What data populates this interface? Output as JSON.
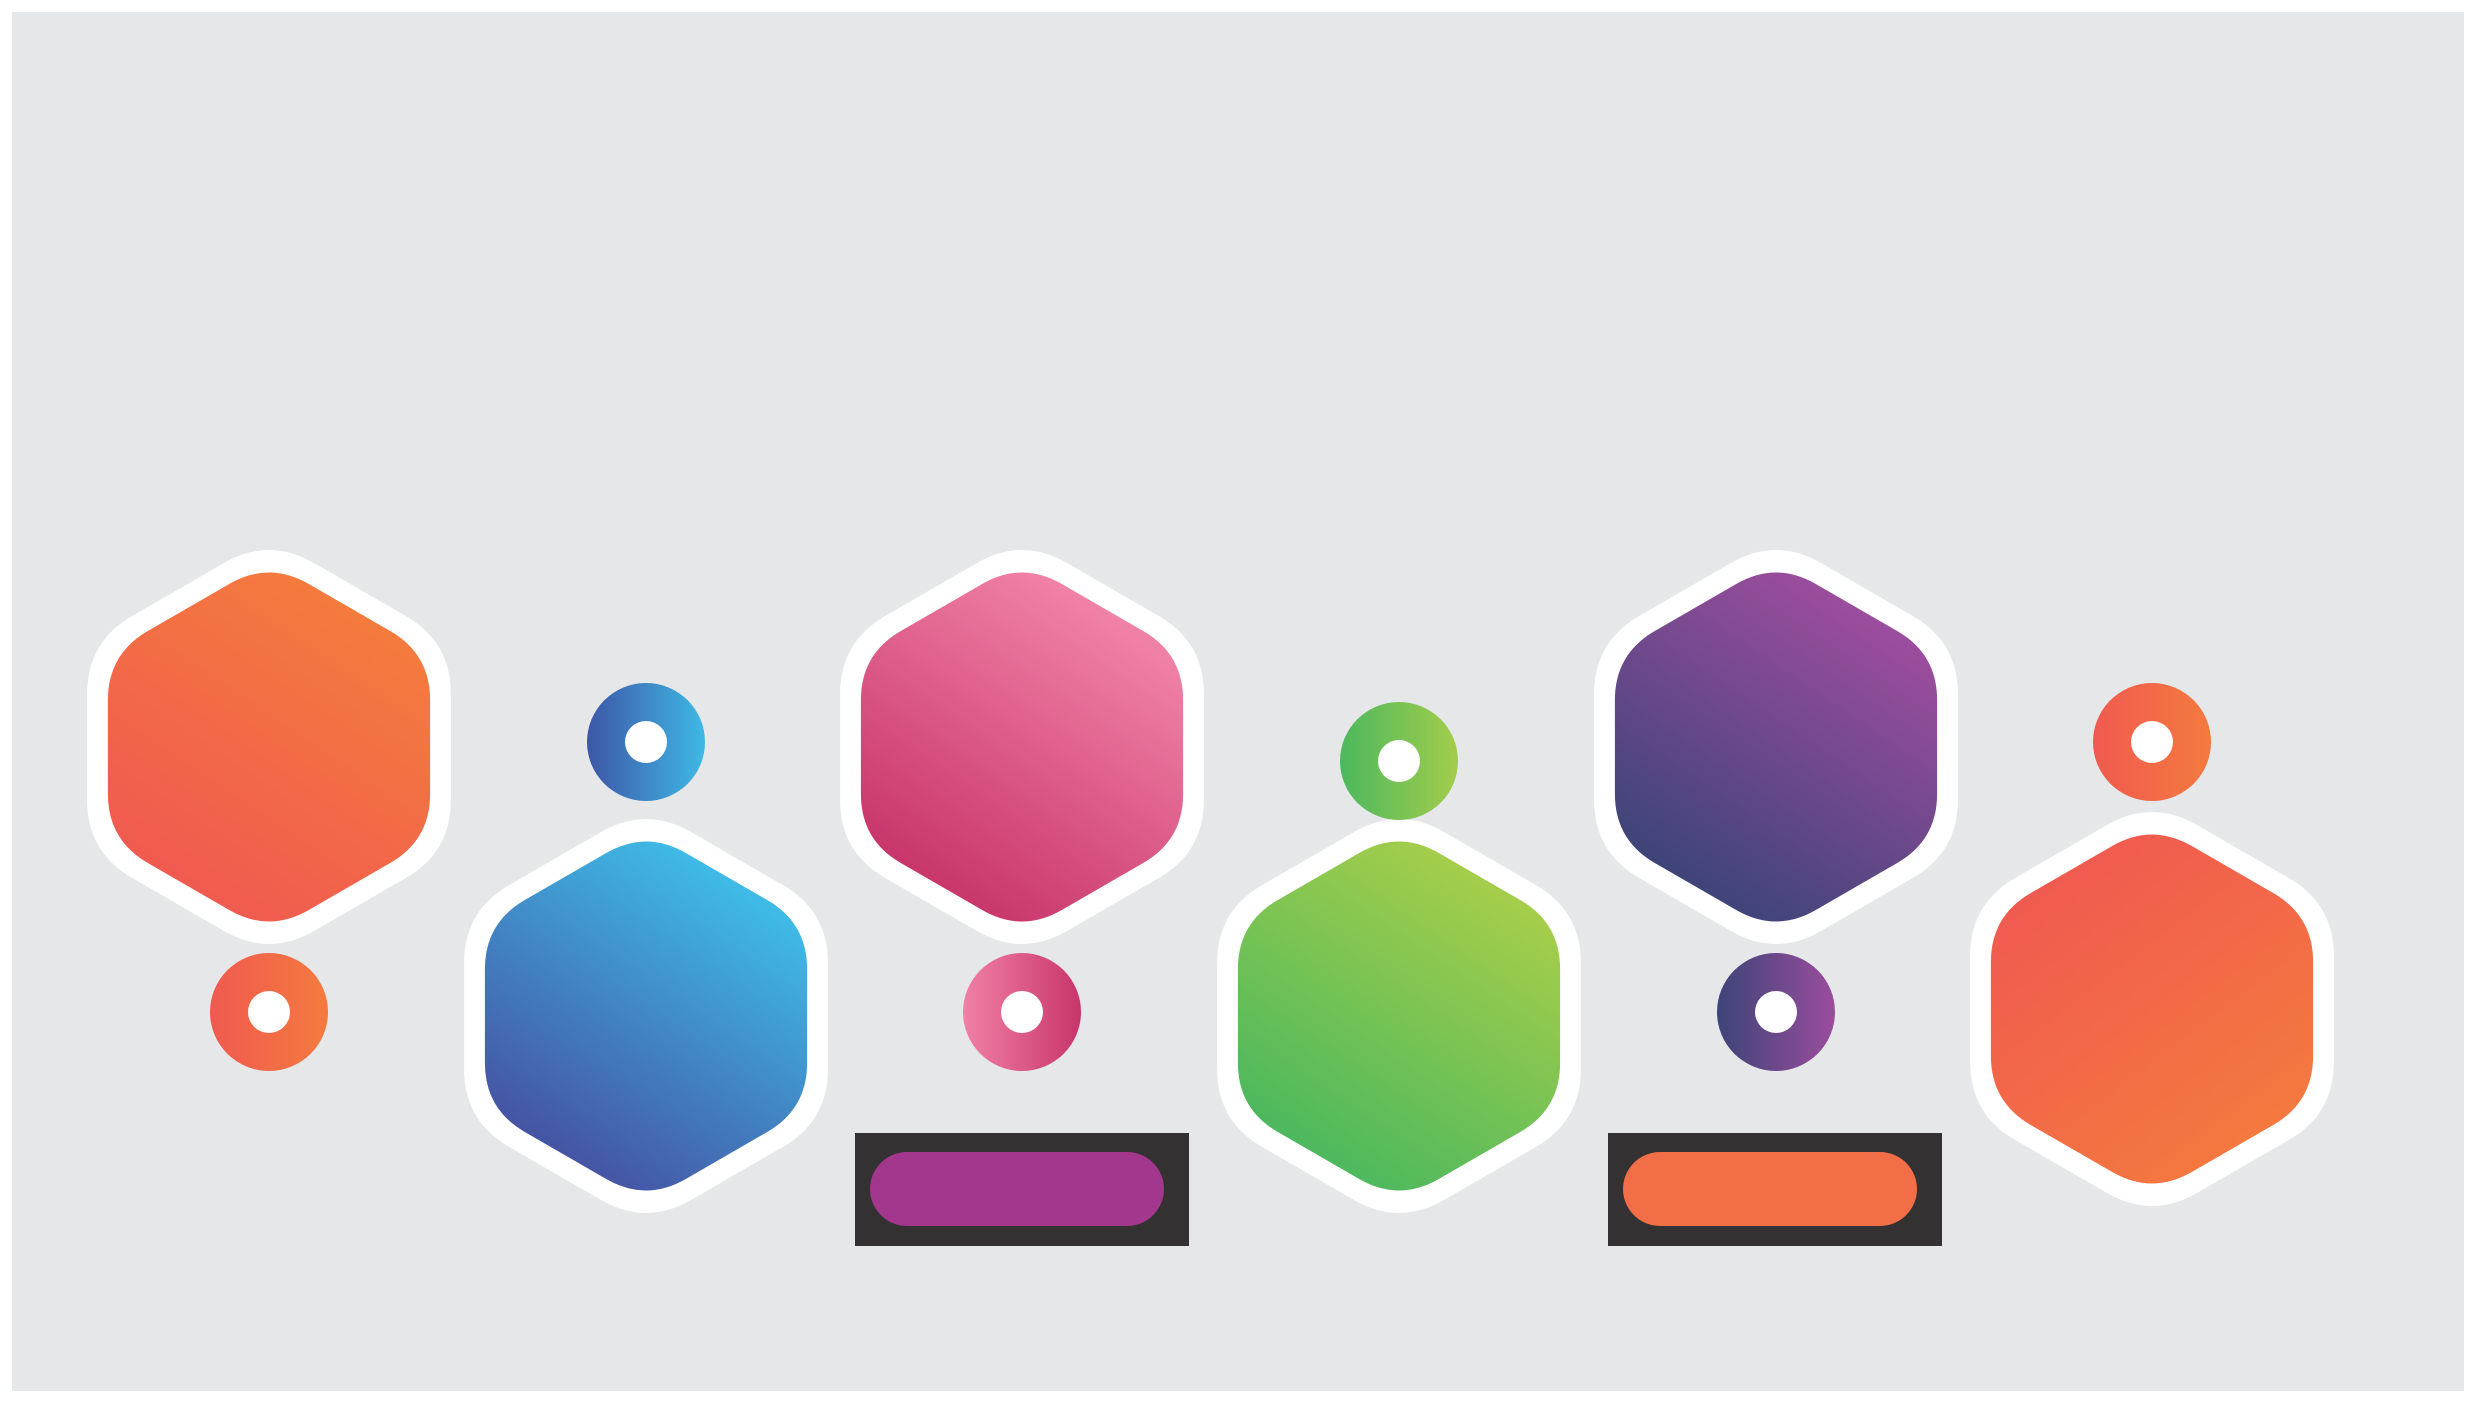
{
  "canvas": {
    "background": "#ffffff",
    "panel_color": "#e6e7e8",
    "ring_color": "#ffffff",
    "bar_frame_color": "#333132"
  },
  "hexagons": [
    {
      "name": "hexagon-orange-1",
      "grad_from": "#f05a50",
      "grad_to": "#f47a3e"
    },
    {
      "name": "hexagon-blue",
      "grad_from": "#4553a3",
      "grad_to": "#3fb9e6"
    },
    {
      "name": "hexagon-pink",
      "grad_from": "#c8356a",
      "grad_to": "#f081a6"
    },
    {
      "name": "hexagon-green",
      "grad_from": "#4cb85e",
      "grad_to": "#a3cd4b"
    },
    {
      "name": "hexagon-purple",
      "grad_from": "#3d4478",
      "grad_to": "#9a4d9c"
    },
    {
      "name": "hexagon-orange-2",
      "grad_from": "#f05a50",
      "grad_to": "#f47a3e"
    }
  ],
  "connector_dots": [
    {
      "name": "dot-orange",
      "grad_from": "#f05a50",
      "grad_to": "#f47a3e"
    },
    {
      "name": "dot-blue",
      "grad_from": "#3d56a6",
      "grad_to": "#3fb9e6"
    },
    {
      "name": "dot-pink",
      "grad_from": "#f081a6",
      "grad_to": "#c8356a"
    },
    {
      "name": "dot-green",
      "grad_from": "#4cb85e",
      "grad_to": "#a3cd4b"
    },
    {
      "name": "dot-purple",
      "grad_from": "#3d4478",
      "grad_to": "#9a4d9c"
    },
    {
      "name": "dot-orange-2",
      "grad_from": "#f05a50",
      "grad_to": "#f47a3e"
    }
  ],
  "label_bars": [
    {
      "name": "label-bar-purple",
      "fill": "#a3378d"
    },
    {
      "name": "label-bar-orange",
      "fill": "#f26e47"
    }
  ]
}
